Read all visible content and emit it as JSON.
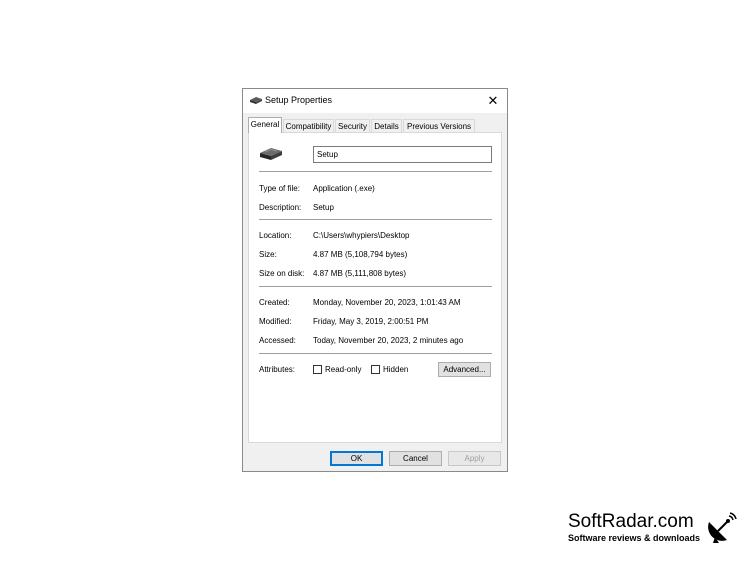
{
  "window": {
    "title": "Setup Properties",
    "close_glyph": "✕",
    "title_icon": "installer-icon"
  },
  "tabs": [
    {
      "label": "General",
      "active": true
    },
    {
      "label": "Compatibility",
      "active": false
    },
    {
      "label": "Security",
      "active": false
    },
    {
      "label": "Details",
      "active": false
    },
    {
      "label": "Previous Versions",
      "active": false
    }
  ],
  "general": {
    "file_icon": "installer-icon",
    "file_name": "Setup",
    "type_label": "Type of file:",
    "type_value": "Application (.exe)",
    "description_label": "Description:",
    "description_value": "Setup",
    "location_label": "Location:",
    "location_value": "C:\\Users\\whypiers\\Desktop",
    "size_label": "Size:",
    "size_value": "4.87 MB (5,108,794 bytes)",
    "size_on_disk_label": "Size on disk:",
    "size_on_disk_value": "4.87 MB (5,111,808 bytes)",
    "created_label": "Created:",
    "created_value": "Monday, November 20, 2023, 1:01:43 AM",
    "modified_label": "Modified:",
    "modified_value": "Friday, May 3, 2019, 2:00:51 PM",
    "accessed_label": "Accessed:",
    "accessed_value": "Today, November 20, 2023, 2 minutes ago",
    "attributes_label": "Attributes:",
    "readonly_label": "Read-only",
    "readonly_checked": false,
    "hidden_label": "Hidden",
    "hidden_checked": false,
    "advanced_label": "Advanced..."
  },
  "buttons": {
    "ok": "OK",
    "cancel": "Cancel",
    "apply": "Apply"
  },
  "watermark": {
    "name": "SoftRadar.com",
    "tagline": "Software reviews & downloads",
    "icon": "satellite-dish-icon"
  },
  "colors": {
    "focus_border": "#0078d7",
    "dialog_bg": "#f0f0f0"
  }
}
